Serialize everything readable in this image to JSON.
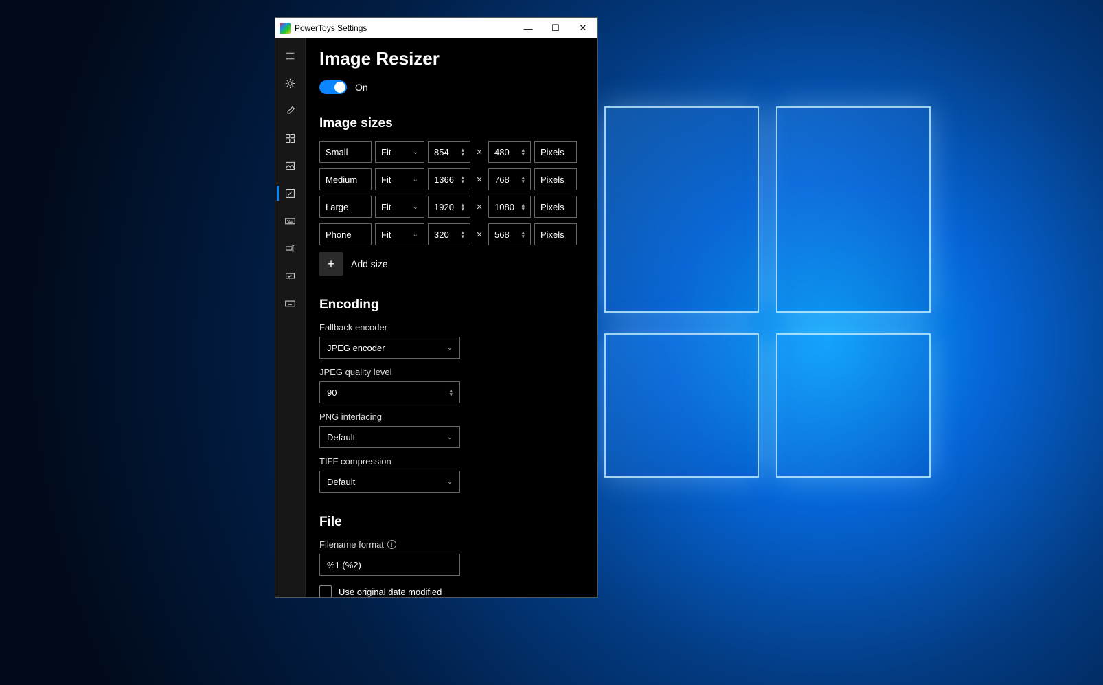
{
  "window": {
    "title": "PowerToys Settings"
  },
  "page": {
    "title": "Image Resizer",
    "toggle_state": "On"
  },
  "sections": {
    "sizes_heading": "Image sizes",
    "encoding_heading": "Encoding",
    "file_heading": "File"
  },
  "sizes": [
    {
      "name": "Small",
      "fit": "Fit",
      "w": "854",
      "h": "480",
      "unit": "Pixels"
    },
    {
      "name": "Medium",
      "fit": "Fit",
      "w": "1366",
      "h": "768",
      "unit": "Pixels"
    },
    {
      "name": "Large",
      "fit": "Fit",
      "w": "1920",
      "h": "1080",
      "unit": "Pixels"
    },
    {
      "name": "Phone",
      "fit": "Fit",
      "w": "320",
      "h": "568",
      "unit": "Pixels"
    }
  ],
  "add_size_label": "Add size",
  "encoding": {
    "fallback_label": "Fallback encoder",
    "fallback_value": "JPEG encoder",
    "jpeg_quality_label": "JPEG quality level",
    "jpeg_quality_value": "90",
    "png_interlacing_label": "PNG interlacing",
    "png_interlacing_value": "Default",
    "tiff_compression_label": "TIFF compression",
    "tiff_compression_value": "Default"
  },
  "file": {
    "filename_format_label": "Filename format",
    "filename_format_value": "%1 (%2)",
    "use_original_date_label": "Use original date modified"
  },
  "nav": {
    "items": [
      "general",
      "color-picker",
      "fancyzones",
      "file-explorer",
      "image-resizer",
      "keyboard-manager",
      "power-rename",
      "run",
      "shortcut-guide"
    ]
  }
}
